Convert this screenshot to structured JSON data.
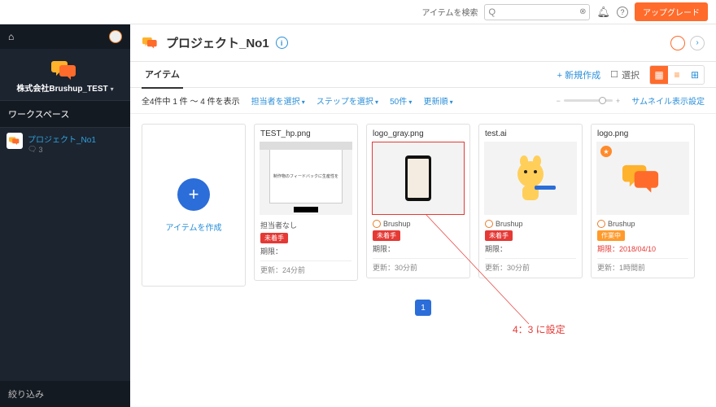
{
  "topbar": {
    "search_label": "アイテムを検索",
    "search_placeholder": "",
    "search_mag": "Q",
    "upgrade_label": "アップグレード"
  },
  "sidebar": {
    "org_name": "株式会社Brushup_TEST",
    "section_label": "ワークスペース",
    "project": {
      "name": "プロジェクト_No1",
      "count": "3"
    },
    "filter_label": "絞り込み"
  },
  "header": {
    "title": "プロジェクト_No1"
  },
  "tabs": {
    "items_label": "アイテム",
    "new_label": "+ 新規作成",
    "select_label": "選択"
  },
  "filters": {
    "count_text": "全4件中 1 件 〜 4 件を表示",
    "assignee": "担当者を選択",
    "step": "ステップを選択",
    "per_page": "50件",
    "sort": "更新順",
    "thumb_settings": "サムネイル表示設定"
  },
  "createCard": {
    "label": "アイテムを作成"
  },
  "items": [
    {
      "filename": "TEST_hp.png",
      "preview_kind": "website",
      "preview_tagline": "制作物のフィードバックに生産性を",
      "assignee": "担当者なし",
      "no_assignee_icon": true,
      "status": "未着手",
      "status_class": "red",
      "due": "期限：",
      "updated": "更新：24分前",
      "bordered": false,
      "pinned": false
    },
    {
      "filename": "logo_gray.png",
      "preview_kind": "phone",
      "assignee": "Brushup",
      "status": "未着手",
      "status_class": "red",
      "due": "期限：",
      "updated": "更新：30分前",
      "bordered": true,
      "pinned": false
    },
    {
      "filename": "test.ai",
      "preview_kind": "mascot",
      "assignee": "Brushup",
      "status": "未着手",
      "status_class": "red",
      "due": "期限：",
      "updated": "更新：30分前",
      "bordered": false,
      "pinned": false
    },
    {
      "filename": "logo.png",
      "preview_kind": "logo",
      "assignee": "Brushup",
      "status": "作業中",
      "status_class": "orange",
      "due": "期限：2018/04/10",
      "due_red": true,
      "updated": "更新：1時間前",
      "bordered": false,
      "pinned": true
    }
  ],
  "pager": {
    "page": "1"
  },
  "annotation": {
    "text": "4：3 に設定"
  }
}
